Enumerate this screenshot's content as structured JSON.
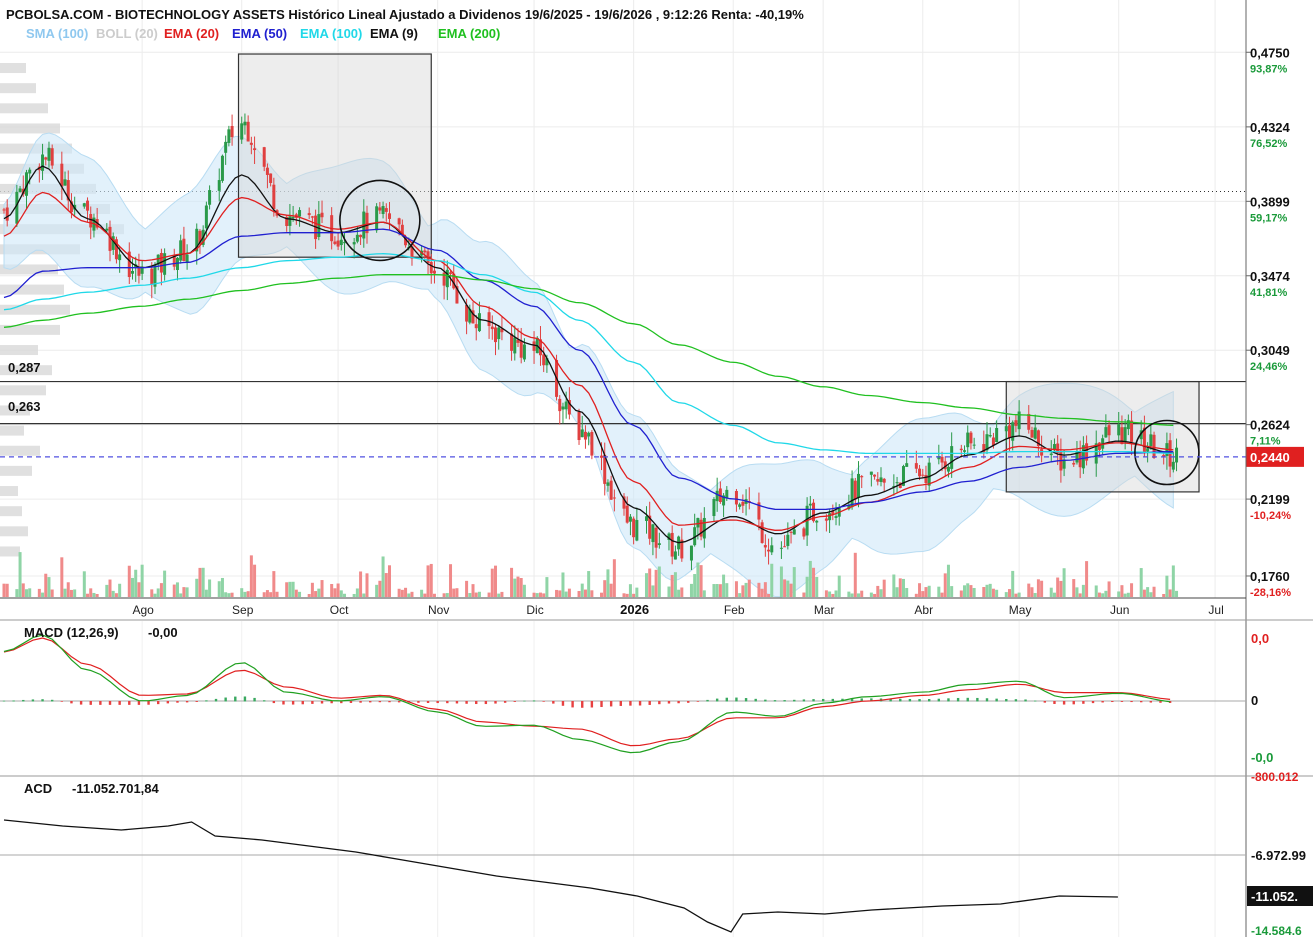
{
  "header": {
    "title": "PCBOLSA.COM - BIOTECHNOLOGY ASSETS Histórico Lineal Ajustado a Dividenos 19/6/2025 - 19/6/2026 , 9:12:26 Renta: -40,19%"
  },
  "legend": [
    {
      "label": "SMA (100)",
      "color": "#8fc8ef"
    },
    {
      "label": "BOLL (20)",
      "color": "#cccccc"
    },
    {
      "label": "EMA (20)",
      "color": "#e02020"
    },
    {
      "label": "EMA (50)",
      "color": "#2020d0"
    },
    {
      "label": "EMA (100)",
      "color": "#20d8e8"
    },
    {
      "label": "EMA (9)",
      "color": "#111111"
    },
    {
      "label": "EMA (200)",
      "color": "#20c020"
    }
  ],
  "indicators": {
    "macd_label": "MACD (12,26,9)",
    "macd_value": "-0,00",
    "acd_label": "ACD",
    "acd_value": "-11.052.701,84",
    "macd_axis": [
      "0,0",
      "0",
      "-0,0"
    ],
    "acd_axis": [
      "-800.012",
      "-6.972.99",
      "-11.052.",
      "-14.584.6"
    ]
  },
  "levels": [
    {
      "label": "0,287",
      "value": 0.287
    },
    {
      "label": "0,263",
      "value": 0.263
    }
  ],
  "price_axis": {
    "ticks": [
      {
        "value": 0.475,
        "label": "0,4750",
        "pct": "93,87%"
      },
      {
        "value": 0.4324,
        "label": "0,4324",
        "pct": "76,52%"
      },
      {
        "value": 0.3899,
        "label": "0,3899",
        "pct": "59,17%"
      },
      {
        "value": 0.3474,
        "label": "0,3474",
        "pct": "41,81%"
      },
      {
        "value": 0.3049,
        "label": "0,3049",
        "pct": "24,46%"
      },
      {
        "value": 0.2624,
        "label": "0,2624",
        "pct": "7,11%"
      },
      {
        "value": 0.2199,
        "label": "0,2199",
        "pct": "-10,24%"
      },
      {
        "value": 0.176,
        "label": "0,1760",
        "pct": "-28,16%"
      }
    ],
    "current": {
      "value": 0.244,
      "label": "0,2440"
    },
    "positive_color": "#1a9a3a",
    "negative_color": "#e02020"
  },
  "months": [
    {
      "label": "Ago",
      "bold": false
    },
    {
      "label": "Sep",
      "bold": false
    },
    {
      "label": "Oct",
      "bold": false
    },
    {
      "label": "Nov",
      "bold": false
    },
    {
      "label": "Dic",
      "bold": false
    },
    {
      "label": "2026",
      "bold": true
    },
    {
      "label": "Feb",
      "bold": false
    },
    {
      "label": "Mar",
      "bold": false
    },
    {
      "label": "Abr",
      "bold": false
    },
    {
      "label": "May",
      "bold": false
    },
    {
      "label": "Jun",
      "bold": false
    },
    {
      "label": "Jul",
      "bold": false
    }
  ],
  "chart_data": {
    "type": "line",
    "title": "PCBOLSA.COM - BIOTECHNOLOGY ASSETS Histórico Lineal Ajustado a Dividenos 19/6/2025 - 19/6/2026 , 9:12:26 Renta: -40,19%",
    "ylim": [
      0.164,
      0.482
    ],
    "x_axis_type": "date",
    "x": [
      "2025-06-19",
      "2025-07-01",
      "2025-07-15",
      "2025-08-01",
      "2025-08-15",
      "2025-09-01",
      "2025-09-15",
      "2025-10-01",
      "2025-10-15",
      "2025-11-01",
      "2025-11-15",
      "2025-12-01",
      "2025-12-15",
      "2026-01-01",
      "2026-01-15",
      "2026-02-01",
      "2026-02-15",
      "2026-03-01",
      "2026-03-15",
      "2026-04-01",
      "2026-04-15",
      "2026-05-01",
      "2026-05-15",
      "2026-06-01",
      "2026-06-19"
    ],
    "series": [
      {
        "name": "Close",
        "values": [
          0.385,
          0.415,
          0.382,
          0.348,
          0.362,
          0.435,
          0.382,
          0.372,
          0.38,
          0.35,
          0.318,
          0.305,
          0.26,
          0.205,
          0.192,
          0.225,
          0.192,
          0.215,
          0.228,
          0.235,
          0.25,
          0.262,
          0.242,
          0.258,
          0.244
        ]
      },
      {
        "name": "EMA (9)",
        "values": [
          0.38,
          0.41,
          0.38,
          0.352,
          0.36,
          0.405,
          0.38,
          0.372,
          0.378,
          0.352,
          0.322,
          0.308,
          0.27,
          0.215,
          0.195,
          0.21,
          0.2,
          0.212,
          0.222,
          0.232,
          0.245,
          0.256,
          0.245,
          0.253,
          0.246
        ]
      },
      {
        "name": "EMA (20)",
        "values": [
          0.37,
          0.395,
          0.378,
          0.356,
          0.36,
          0.392,
          0.382,
          0.374,
          0.378,
          0.356,
          0.33,
          0.312,
          0.285,
          0.23,
          0.205,
          0.208,
          0.202,
          0.21,
          0.218,
          0.228,
          0.238,
          0.25,
          0.248,
          0.252,
          0.248
        ]
      },
      {
        "name": "EMA (50)",
        "values": [
          0.335,
          0.35,
          0.352,
          0.352,
          0.355,
          0.37,
          0.372,
          0.372,
          0.374,
          0.362,
          0.345,
          0.33,
          0.305,
          0.262,
          0.232,
          0.22,
          0.214,
          0.214,
          0.218,
          0.224,
          0.23,
          0.238,
          0.242,
          0.246,
          0.247
        ]
      },
      {
        "name": "EMA (100)",
        "values": [
          0.328,
          0.334,
          0.338,
          0.342,
          0.346,
          0.352,
          0.356,
          0.358,
          0.36,
          0.356,
          0.348,
          0.338,
          0.322,
          0.298,
          0.275,
          0.262,
          0.252,
          0.248,
          0.246,
          0.246,
          0.246,
          0.247,
          0.247,
          0.247,
          0.246
        ]
      },
      {
        "name": "EMA (200)",
        "values": [
          0.318,
          0.322,
          0.326,
          0.33,
          0.334,
          0.339,
          0.343,
          0.346,
          0.348,
          0.348,
          0.345,
          0.34,
          0.332,
          0.32,
          0.308,
          0.298,
          0.29,
          0.284,
          0.279,
          0.275,
          0.272,
          0.268,
          0.266,
          0.264,
          0.262
        ]
      }
    ],
    "macd": {
      "ylabel": "MACD (12,26,9)",
      "value": "-0,00"
    },
    "acd": {
      "ylabel": "ACD",
      "value": "-11.052.701,84"
    },
    "grid": true,
    "legend_position": "top-left"
  }
}
